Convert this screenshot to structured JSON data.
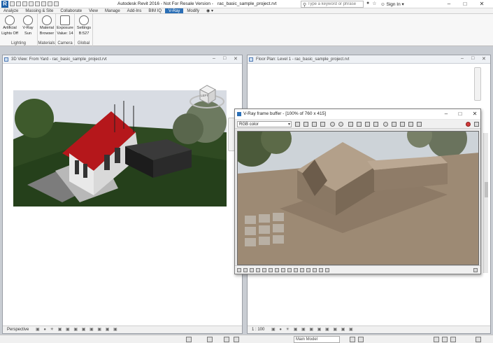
{
  "app": {
    "title": "Autodesk Revit 2016 - Not For Resale Version -",
    "file": "rac_basic_sample_project.rvt",
    "logo_letter": "R"
  },
  "search": {
    "placeholder": "Type a keyword or phrase"
  },
  "signin_label": "Sign In",
  "window_controls": {
    "minimize": "–",
    "maximize": "□",
    "close": "✕"
  },
  "ribbon": {
    "tabs": [
      "Analyze",
      "Massing & Site",
      "Collaborate",
      "View",
      "Manage",
      "Add-Ins",
      "BIM IQ",
      "V-Ray",
      "Modify"
    ],
    "active_tab": "V-Ray",
    "groups": [
      {
        "label": "Lighting",
        "buttons": [
          {
            "line1": "Artificial",
            "line2": "Lights Off",
            "icon": "lightbulb-icon"
          },
          {
            "line1": "V-Ray",
            "line2": "Sun",
            "icon": "sun-icon"
          }
        ]
      },
      {
        "label": "Materials",
        "buttons": [
          {
            "line1": "Material",
            "line2": "Browser",
            "icon": "sphere-icon"
          }
        ]
      },
      {
        "label": "Camera",
        "buttons": [
          {
            "line1": "Exposure",
            "line2": "Value: 14",
            "icon": "camera-icon"
          }
        ]
      },
      {
        "label": "Global",
        "buttons": [
          {
            "line1": "Settings",
            "line2": "B:527",
            "icon": "gear-icon"
          }
        ]
      }
    ]
  },
  "views": {
    "left_title": "3D View: From Yard - rac_basic_sample_project.rvt",
    "left_status": "Perspective",
    "right_title": "Floor Plan: Level 1 - rac_basic_sample_project.rvt",
    "right_status": "1 : 100",
    "viewcube_label": "LEFT"
  },
  "vfb": {
    "title": "V-Ray frame buffer - [100% of 760 x 415]",
    "channel": "RGB color"
  },
  "statusbar": {
    "model": "Main Model"
  }
}
